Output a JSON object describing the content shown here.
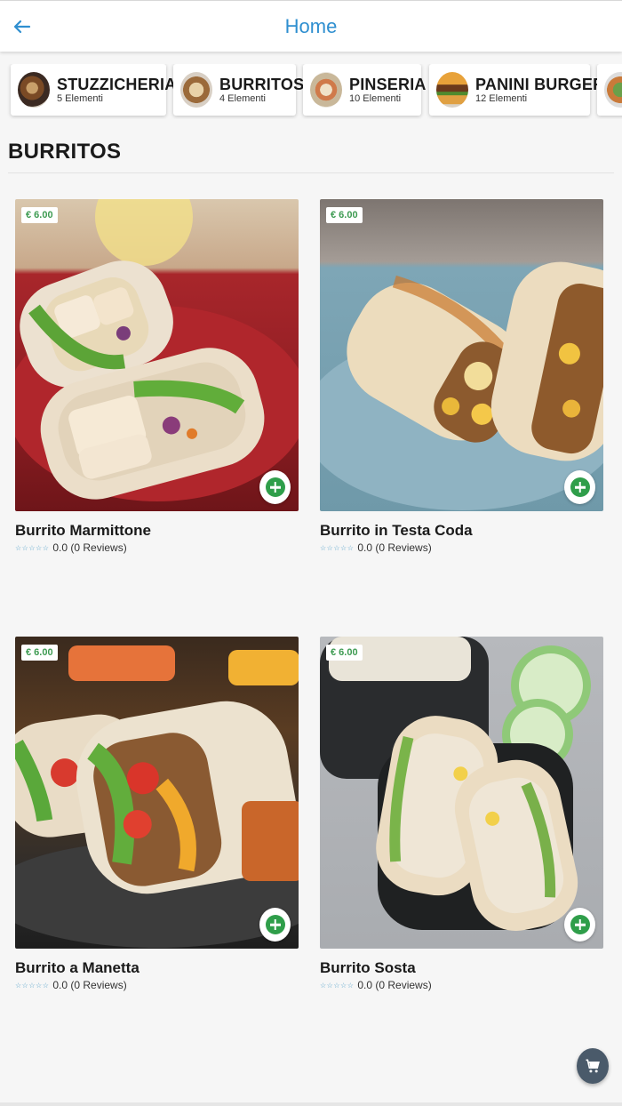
{
  "appbar": {
    "title": "Home",
    "back_icon": "arrow-left-icon",
    "accent": "#2f8fd0"
  },
  "categories": [
    {
      "name": "STUZZICHERIA",
      "count": "5 Elementi"
    },
    {
      "name": "BURRITOS",
      "count": "4 Elementi"
    },
    {
      "name": "PINSERIA",
      "count": "10 Elementi"
    },
    {
      "name": "PANINI BURGER",
      "count": "12 Elementi"
    },
    {
      "name": "",
      "count": ""
    }
  ],
  "section": {
    "title": "BURRITOS"
  },
  "products": [
    {
      "name": "Burrito Marmittone",
      "price": "€ 6.00",
      "rating": "0.0 (0 Reviews)",
      "stars": "☆☆☆☆☆"
    },
    {
      "name": "Burrito in Testa Coda",
      "price": "€ 6.00",
      "rating": "0.0 (0 Reviews)",
      "stars": "☆☆☆☆☆"
    },
    {
      "name": "Burrito a Manetta",
      "price": "€ 6.00",
      "rating": "0.0 (0 Reviews)",
      "stars": "☆☆☆☆☆"
    },
    {
      "name": "Burrito Sosta",
      "price": "€ 6.00",
      "rating": "0.0 (0 Reviews)",
      "stars": "☆☆☆☆☆"
    }
  ],
  "cart": {
    "icon": "cart-icon"
  },
  "colors": {
    "price_green": "#3e9b52",
    "add_green": "#2f9e4a",
    "star_blue": "#4f9fc9",
    "fab": "#4a5a6a"
  }
}
